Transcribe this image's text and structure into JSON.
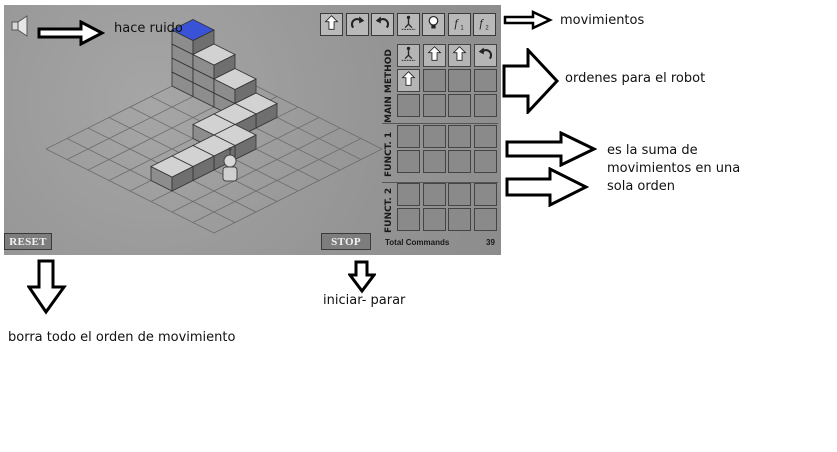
{
  "game": {
    "toolbar": [
      {
        "icon": "forward-arrow-icon"
      },
      {
        "icon": "turn-right-icon"
      },
      {
        "icon": "turn-left-icon"
      },
      {
        "icon": "jump-icon"
      },
      {
        "icon": "light-bulb-icon"
      },
      {
        "icon": "function-1-icon",
        "label": "f1"
      },
      {
        "icon": "function-2-icon",
        "label": "f2"
      }
    ],
    "main_label": "MAIN  METHOD",
    "f1_label": "FUNCT. 1",
    "f2_label": "FUNCT. 2",
    "main_slots": [
      "jump-icon",
      "forward-arrow-icon",
      "forward-arrow-icon",
      "turn-left-icon",
      "forward-arrow-icon",
      "",
      "",
      "",
      "",
      "",
      "",
      ""
    ],
    "reset_label": "RESET",
    "stop_label": "STOP",
    "total_label": "Total Commands",
    "total_value": "39"
  },
  "annotations": {
    "sound": "hace ruido",
    "moves": "movimientos",
    "orders": "ordenes para el robot",
    "functions": "es la suma de movimientos en una sola orden",
    "reset": "borra todo el orden de movimiento",
    "stop": "iniciar- parar"
  }
}
